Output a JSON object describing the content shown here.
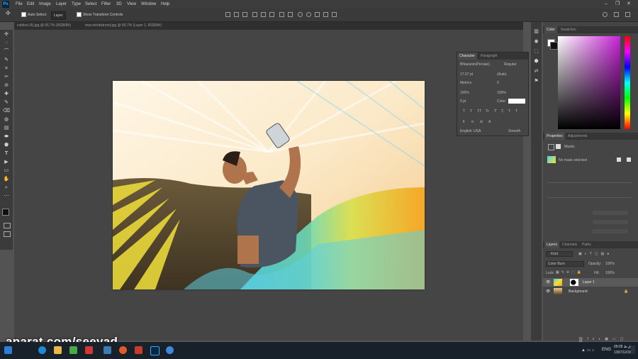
{
  "app": {
    "logo": "Ps"
  },
  "menu": [
    "File",
    "Edit",
    "Image",
    "Layer",
    "Type",
    "Select",
    "Filter",
    "3D",
    "View",
    "Window",
    "Help"
  ],
  "window_controls": {
    "minimize": "–",
    "restore": "❐",
    "close": "✕"
  },
  "options": {
    "auto_select_label": "Auto-Select:",
    "auto_select_value": "Layer",
    "show_transform_label": "Show Transform Controls"
  },
  "tabs": [
    {
      "label": "coldest (4).jpg @ 66.7% (RGB/8#)"
    },
    {
      "label": "man-drinkstrond.jpg @ 66.7% (Layer 1, RGB/8#)"
    }
  ],
  "tools": [
    "✣",
    "◌",
    "⌒",
    "✎",
    "⌗",
    "✂",
    "⊘",
    "✚",
    "✎",
    "⌫",
    "◍",
    "▤",
    "⬬",
    "⬟",
    "T",
    "▶",
    "▭",
    "✋",
    "⌕",
    "⋯"
  ],
  "dock_icons": [
    "▥",
    "◉",
    "⬚",
    "⬢",
    "⇄",
    "⚑"
  ],
  "character_panel": {
    "tabs": [
      "Character",
      "Paragraph"
    ],
    "font_family": "BNazanin(Persian)",
    "font_style": "Regular",
    "font_size": "17.07 pt",
    "leading": "(Auto)",
    "kerning": "Metrics",
    "tracking": "0",
    "v_scale": "100%",
    "h_scale": "100%",
    "baseline": "0 pt",
    "color_label": "Color:",
    "style_buttons": [
      "T",
      "T",
      "TT",
      "Tr",
      "T'",
      "T,",
      "T",
      "T"
    ],
    "language": "English: USA",
    "anti_alias": "Smooth"
  },
  "color_panel": {
    "tabs": [
      "Color",
      "Swatches"
    ]
  },
  "properties_panel": {
    "tabs": [
      "Properties",
      "Adjustments"
    ],
    "mask_label": "Masks",
    "no_mask": "No mask selected"
  },
  "layers_panel": {
    "tabs": [
      "Layers",
      "Channels",
      "Paths"
    ],
    "kind": "Kind",
    "blend_mode": "Color Burn",
    "opacity_label": "Opacity:",
    "opacity": "100%",
    "lock_label": "Lock:",
    "fill_label": "Fill:",
    "fill": "100%",
    "layers": [
      {
        "name": "Layer 1",
        "selected": true
      },
      {
        "name": "Background",
        "selected": false
      }
    ]
  },
  "watermark": "aparat.com/seeyad",
  "taskbar": {
    "lang": "ENG",
    "time": "09:05 ق.ظ",
    "date": "1397/12/16"
  }
}
